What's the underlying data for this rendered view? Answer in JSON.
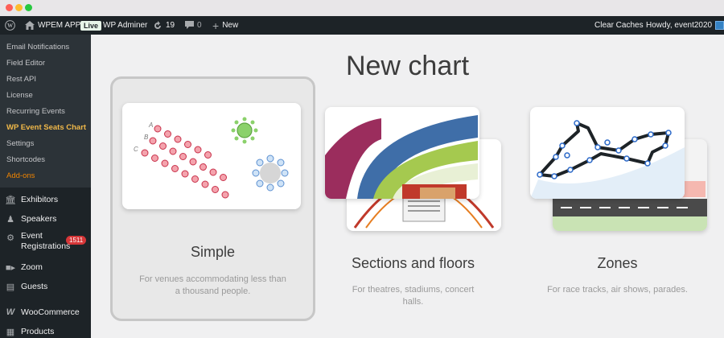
{
  "adminbar": {
    "site_name": "WPEM APP",
    "live": "Live",
    "admin_name": "WP Adminer",
    "updates": "19",
    "comments": "0",
    "new": "New",
    "clear_caches": "Clear Caches",
    "howdy": "Howdy, event2020"
  },
  "sidebar": {
    "submenu": [
      "Email Notifications",
      "Field Editor",
      "Rest API",
      "License",
      "Recurring Events",
      "WP Event Seats Chart",
      "Settings",
      "Shortcodes",
      "Add-ons"
    ],
    "menu": [
      {
        "label": "Exhibitors",
        "icon": "building-icon"
      },
      {
        "label": "Speakers",
        "icon": "users-icon"
      },
      {
        "label": "Event",
        "label2": "Registrations",
        "badge": "1511",
        "icon": "registrations-icon"
      },
      {
        "label": "Zoom",
        "icon": "video-icon"
      },
      {
        "label": "Guests",
        "icon": "guests-icon"
      },
      {
        "label": "WooCommerce",
        "icon": "woocommerce-icon"
      },
      {
        "label": "Products",
        "icon": "products-icon"
      }
    ]
  },
  "main": {
    "title": "New chart",
    "cards": [
      {
        "title": "Simple",
        "desc": "For venues accommodating less than a thousand people."
      },
      {
        "title": "Sections and floors",
        "desc": "For theatres, stadiums, concert halls."
      },
      {
        "title": "Zones",
        "desc": "For race tracks, air shows, parades."
      }
    ],
    "row_labels": [
      "A",
      "B",
      "C"
    ]
  }
}
